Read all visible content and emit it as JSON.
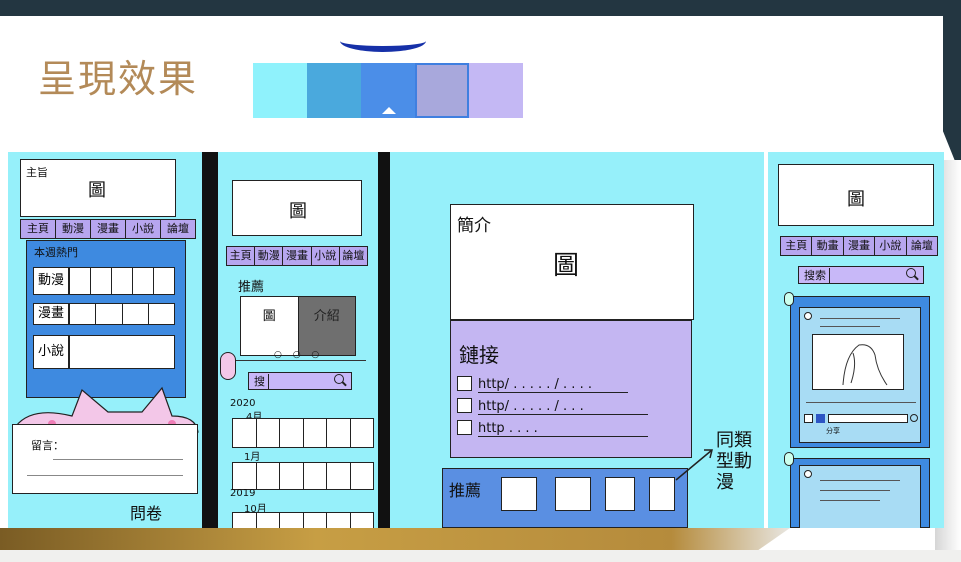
{
  "slide": {
    "title": "呈現效果",
    "palette": [
      "#8ff2fc",
      "#4aa9dd",
      "#4b8ee8",
      "#a8a8dc",
      "#c4b8f4"
    ]
  },
  "sketch1": {
    "theme_label": "主旨",
    "banner_label": "圖",
    "tabs": [
      "主頁",
      "動漫",
      "漫畫",
      "小說",
      "論壇"
    ],
    "weekly_label": "本週熱門",
    "rows": [
      "動漫",
      "漫畫",
      "小說"
    ],
    "comment_label": "留言：",
    "survey_label": "問卷"
  },
  "sketch2": {
    "banner_label": "圖",
    "tabs": [
      "主頁",
      "動漫",
      "漫畫",
      "小說",
      "論壇"
    ],
    "recommend_label": "推薦",
    "card_image_label": "圖",
    "card_intro_label": "介紹",
    "search_label": "搜",
    "dates": [
      "2020",
      "4月",
      "1月",
      "2019",
      "10月"
    ]
  },
  "sketch3": {
    "intro_label": "簡介",
    "image_label": "圖",
    "links_label": "鏈接",
    "links": [
      "http/ . . . . . / . . . .",
      "http/ . . . . . / . . .",
      "http . . . ."
    ],
    "recommend_label": "推薦",
    "similar_label": "同類型動漫"
  },
  "sketch4": {
    "banner_label": "圖",
    "tabs": [
      "主頁",
      "動畫",
      "漫畫",
      "小說",
      "論壇"
    ],
    "search_label": "搜索",
    "share_label": "分享"
  }
}
